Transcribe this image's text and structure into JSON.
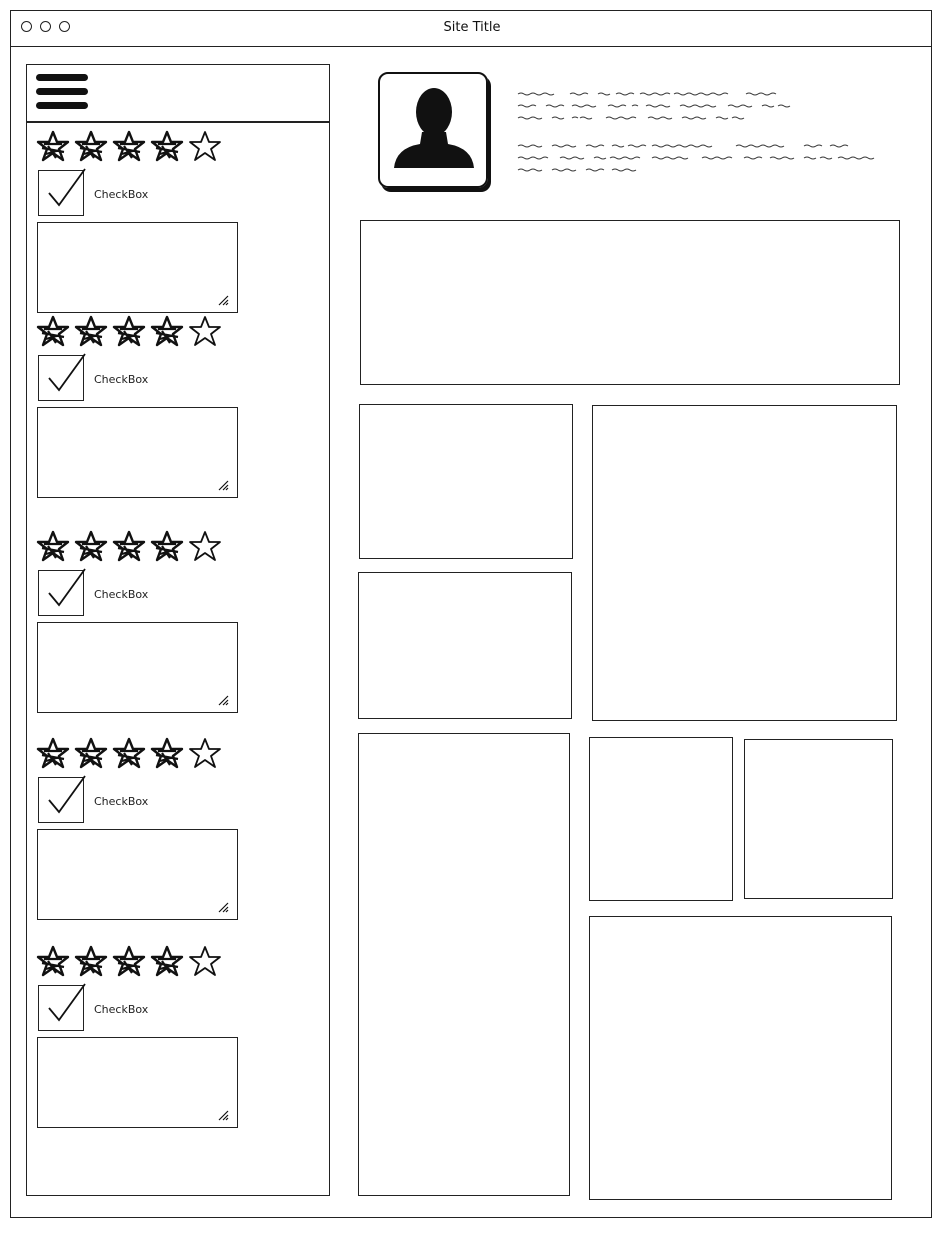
{
  "window": {
    "title": "Site Title"
  },
  "sidebar": {
    "items": [
      {
        "rating": 4,
        "max": 5,
        "checkbox_label": "CheckBox",
        "checked": true
      },
      {
        "rating": 4,
        "max": 5,
        "checkbox_label": "CheckBox",
        "checked": true
      },
      {
        "rating": 4,
        "max": 5,
        "checkbox_label": "CheckBox",
        "checked": true
      },
      {
        "rating": 4,
        "max": 5,
        "checkbox_label": "CheckBox",
        "checked": true
      },
      {
        "rating": 4,
        "max": 5,
        "checkbox_label": "CheckBox",
        "checked": true
      }
    ]
  },
  "icons": {
    "menu": "hamburger-menu-icon",
    "avatar": "user-silhouette-icon",
    "star": "star-icon",
    "check": "checkmark-icon",
    "resize": "resize-grip-icon"
  },
  "colors": {
    "ink": "#111111",
    "background": "#ffffff"
  }
}
